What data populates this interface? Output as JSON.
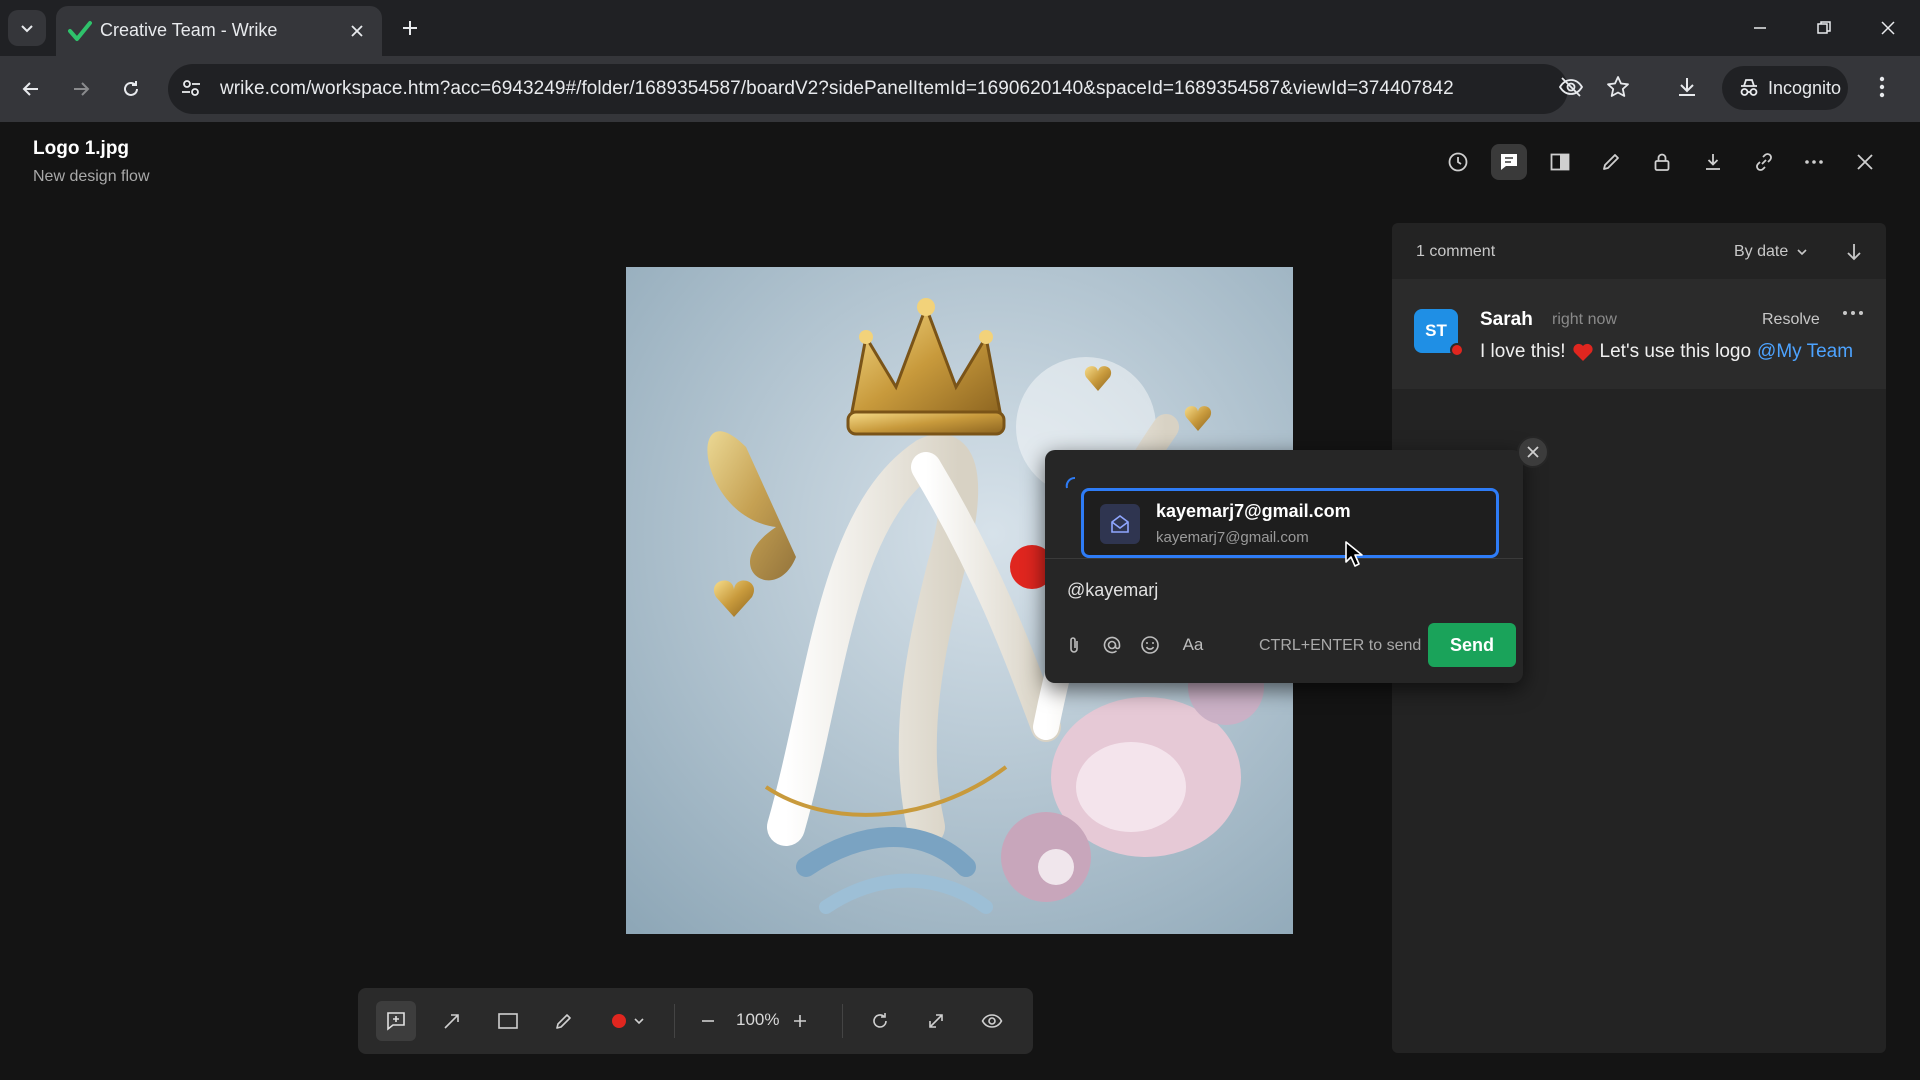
{
  "browser": {
    "tab_title": "Creative Team - Wrike",
    "url": "wrike.com/workspace.htm?acc=6943249#/folder/1689354587/boardV2?sidePanelItemId=1690620140&spaceId=1689354587&viewId=374407842",
    "incognito_label": "Incognito"
  },
  "file": {
    "title": "Logo 1.jpg",
    "subtitle": "New design flow"
  },
  "comments": {
    "count_label": "1 comment",
    "sort_label": "By date",
    "items": [
      {
        "avatar_initials": "ST",
        "author": "Sarah",
        "time": "right now",
        "resolve_label": "Resolve",
        "text_before": "I love this!",
        "text_after": "Let's use this logo",
        "mention": "@My Team"
      }
    ]
  },
  "reply": {
    "suggestion_name": "kayemarj7@gmail.com",
    "suggestion_email": "kayemarj7@gmail.com",
    "input_value": "@kayemarj",
    "send_hint": "CTRL+ENTER to send",
    "send_label": "Send"
  },
  "toolbar": {
    "zoom": "100%",
    "pen_color": "#e0261f"
  },
  "colors": {
    "accent_blue": "#2e7cf6",
    "send_green": "#1aa35a",
    "mention_blue": "#4da3ff",
    "avatar_blue": "#1f8fe5"
  }
}
